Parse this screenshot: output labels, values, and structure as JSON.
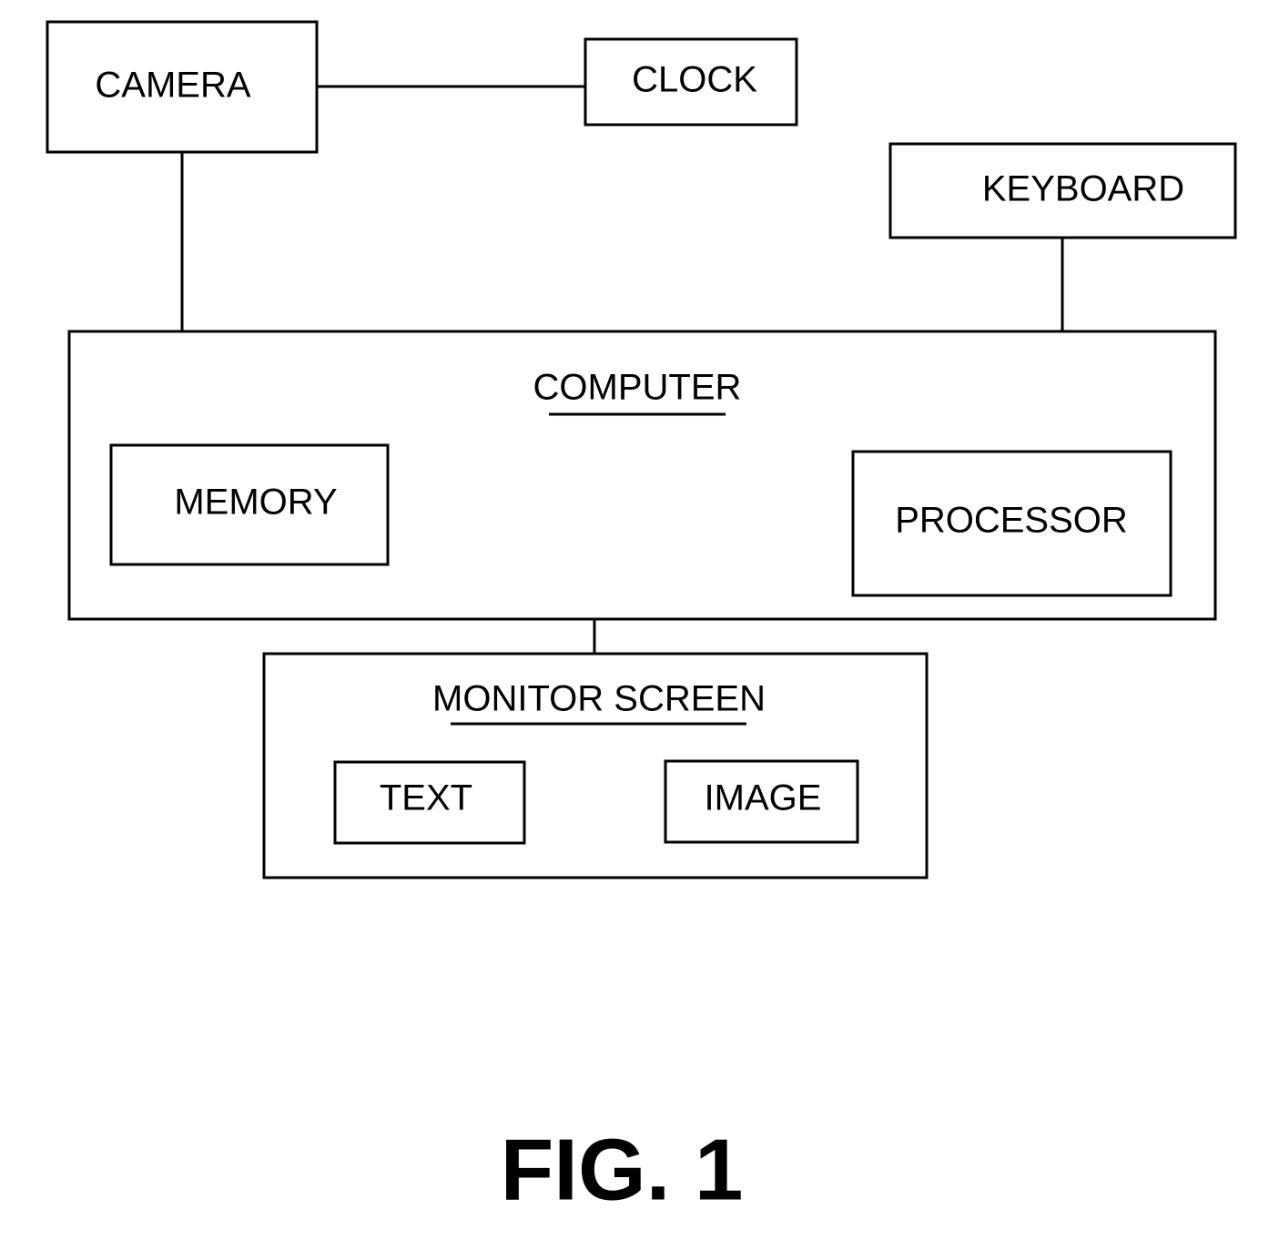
{
  "diagram": {
    "figure_label": "FIG. 1",
    "nodes": {
      "camera": {
        "label": "CAMERA"
      },
      "clock": {
        "label": "CLOCK"
      },
      "keyboard": {
        "label": "KEYBOARD"
      },
      "computer": {
        "label": "COMPUTER",
        "underlined": true
      },
      "memory": {
        "label": "MEMORY",
        "parent": "computer"
      },
      "processor": {
        "label": "PROCESSOR",
        "parent": "computer"
      },
      "monitor_screen": {
        "label": "MONITOR SCREEN",
        "underlined": true
      },
      "text": {
        "label": "TEXT",
        "parent": "monitor_screen"
      },
      "image": {
        "label": "IMAGE",
        "parent": "monitor_screen"
      }
    },
    "edges": [
      {
        "from": "camera",
        "to": "clock"
      },
      {
        "from": "camera",
        "to": "computer"
      },
      {
        "from": "keyboard",
        "to": "computer"
      },
      {
        "from": "computer",
        "to": "monitor_screen"
      }
    ]
  }
}
